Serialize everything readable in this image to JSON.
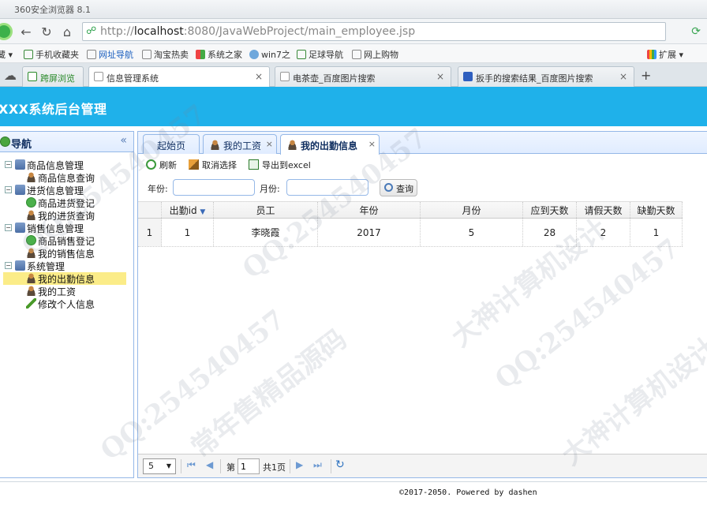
{
  "browser": {
    "window_title": "360安全浏览器 8.1",
    "url_prefix": "http://",
    "url_host": "localhost",
    "url_rest": ":8080/JavaWebProject/main_employee.jsp",
    "bookmarks": [
      "藏",
      "手机收藏夹",
      "网址导航",
      "淘宝热卖",
      "系统之家",
      "win7之",
      "足球导航",
      "网上购物",
      "扩展"
    ],
    "tabs": [
      {
        "label": "跨屏浏览"
      },
      {
        "label": "信息管理系统"
      },
      {
        "label": "电茶壶_百度图片搜索"
      },
      {
        "label": "扳手的搜索结果_百度图片搜索"
      }
    ]
  },
  "app": {
    "title": "XXX系统后台管理",
    "nav": {
      "title": "导航",
      "collapse": "«",
      "groups": [
        {
          "label": "商品信息管理",
          "items": [
            "商品信息查询"
          ]
        },
        {
          "label": "进货信息管理",
          "items": [
            "商品进货登记",
            "我的进货查询"
          ]
        },
        {
          "label": "销售信息管理",
          "items": [
            "商品销售登记",
            "我的销售信息"
          ]
        },
        {
          "label": "系统管理",
          "items": [
            "我的出勤信息",
            "我的工资",
            "修改个人信息"
          ]
        }
      ]
    },
    "tabs": [
      {
        "label": "起始页"
      },
      {
        "label": "我的工资"
      },
      {
        "label": "我的出勤信息"
      }
    ],
    "toolbar": {
      "refresh": "刷新",
      "unselect": "取消选择",
      "export": "导出到excel"
    },
    "filter": {
      "year_label": "年份:",
      "month_label": "月份:",
      "year_value": "",
      "month_value": "",
      "query": "查询"
    },
    "grid": {
      "columns": [
        "出勤id",
        "员工",
        "年份",
        "月份",
        "应到天数",
        "请假天数",
        "缺勤天数"
      ],
      "rows": [
        {
          "rownum": "1",
          "cells": [
            "1",
            "李晓霞",
            "2017",
            "5",
            "28",
            "2",
            "1"
          ]
        }
      ]
    },
    "pager": {
      "page_size": "5",
      "page_prefix": "第",
      "page_value": "1",
      "page_total": "共1页"
    },
    "footer": "©2017-2050. Powered by dashen"
  },
  "watermark": {
    "lines": [
      "QQ:254540457",
      "常年售精品源码",
      "大神计算机设计"
    ]
  },
  "colors": {
    "header": "#1fb1ea",
    "panel_border": "#95b8e7",
    "selected_node": "#fbec88"
  }
}
